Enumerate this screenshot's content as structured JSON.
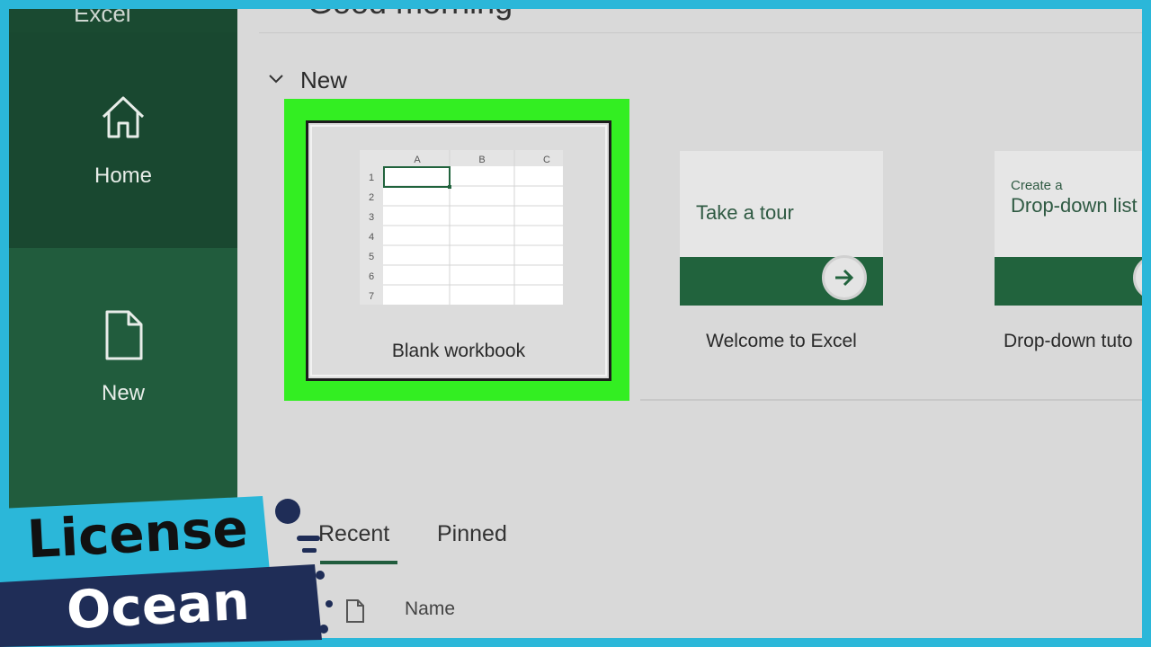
{
  "app": {
    "name": "Excel",
    "greeting": "Good morning"
  },
  "sidebar": {
    "items": [
      {
        "label": "Home",
        "icon": "home-icon"
      },
      {
        "label": "New",
        "icon": "new-document-icon"
      }
    ]
  },
  "new_section": {
    "heading": "New",
    "templates": [
      {
        "title": "Blank workbook",
        "grid_cols": [
          "A",
          "B",
          "C"
        ],
        "grid_rows": [
          "1",
          "2",
          "3",
          "4",
          "5",
          "6",
          "7"
        ]
      },
      {
        "title": "Welcome to Excel",
        "card_text": "Take a tour"
      },
      {
        "title": "Drop-down tuto",
        "card_small": "Create a",
        "card_text": "Drop-down list"
      }
    ]
  },
  "files": {
    "tabs": [
      "Recent",
      "Pinned"
    ],
    "active_tab": "Recent",
    "columns": [
      "Name"
    ]
  },
  "colors": {
    "sidebar": "#215c3d",
    "highlight": "#33ee22",
    "accent": "#21633d",
    "border": "#2bb7d9"
  },
  "watermark": {
    "line1": "License",
    "line2": "Ocean"
  }
}
